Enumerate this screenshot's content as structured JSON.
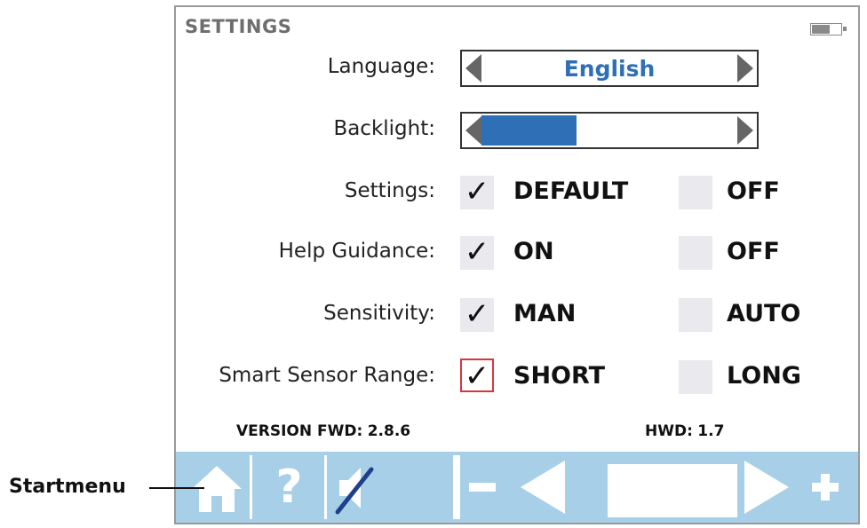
{
  "screen": {
    "title": "SETTINGS",
    "language": {
      "label": "Language:",
      "value": "English"
    },
    "backlight": {
      "label": "Backlight:",
      "level": 0.37
    },
    "rows": [
      {
        "label": "Settings:",
        "option_a": "DEFAULT",
        "option_b": "OFF",
        "checked": "a"
      },
      {
        "label": "Help Guidance:",
        "option_a": "ON",
        "option_b": "OFF",
        "checked": "a"
      },
      {
        "label": "Sensitivity:",
        "option_a": "MAN",
        "option_b": "AUTO",
        "checked": "a"
      },
      {
        "label": "Smart Sensor Range:",
        "option_a": "SHORT",
        "option_b": "LONG",
        "checked": "a"
      }
    ],
    "check_glyph": "✓",
    "version": {
      "fwd_label": "VERSION FWD:",
      "fwd_value": "2.8.6",
      "hwd_label": "HWD:",
      "hwd_value": "1.7"
    },
    "toolbar": {
      "help_label": "?"
    }
  },
  "annotation": {
    "label": "Startmenu"
  },
  "colors": {
    "accent": "#2f6fb6",
    "toolbar": "#a7cfe8",
    "focus": "#d9363b"
  },
  "icons": [
    "battery-icon",
    "home-icon",
    "help-icon",
    "mute-icon",
    "minus-icon",
    "left-arrow-icon",
    "right-arrow-icon",
    "plus-icon"
  ]
}
